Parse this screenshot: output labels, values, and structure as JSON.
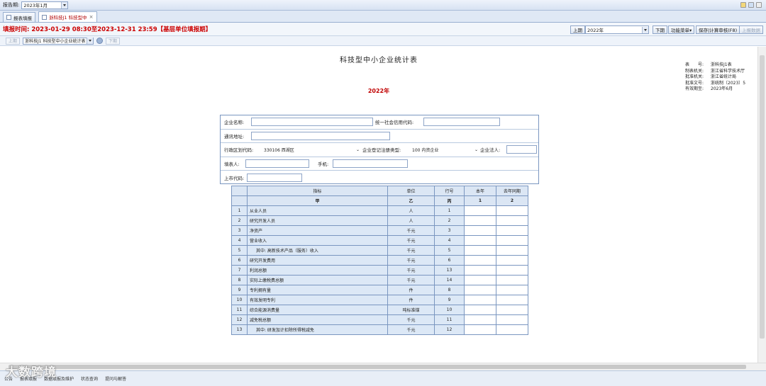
{
  "topbar": {
    "period_label": "报告期:",
    "period_value": "2023年1月"
  },
  "tabs": [
    {
      "label": "报表填报"
    },
    {
      "label": "浙科技J1 科技型中"
    }
  ],
  "timebar": {
    "fill_time": "填报时间: 2023-01-29 08:30至2023-12-31 23:59【基层单位填报期】",
    "prev_btn": "上期",
    "year_value": "2022年",
    "next_btn": "下期",
    "func_menu": "功能菜单▾",
    "save_btn": "保存|计算审核(F8)",
    "report_btn": "上报数据"
  },
  "toolbar2": {
    "btn_prev": "上期",
    "table_select": "浙科技J1 科技型中小企业统计表",
    "btn_next": "下期"
  },
  "form": {
    "title": "科技型中小企业统计表",
    "year": "2022年",
    "meta": [
      {
        "k": "表　　号:",
        "v": "浙科技J1表"
      },
      {
        "k": "制表机关:",
        "v": "浙江省科学技术厅"
      },
      {
        "k": "批准机关:",
        "v": "浙江省统计局"
      },
      {
        "k": "批准文号:",
        "v": "浙统制〔2023〕5"
      },
      {
        "k": "有效期至:",
        "v": "2023年6月"
      }
    ]
  },
  "info": {
    "company_name_label": "企业名称:",
    "credit_code_label": "统一社会信用代码:",
    "address_label": "通讯地址:",
    "region_label": "行政区划代码:",
    "region_value": "330106 西湖区",
    "reg_type_label": "企业登记注册类型:",
    "reg_type_value": "100 内资企业",
    "legal_label": "企业法人:",
    "filler_label": "填表人:",
    "mobile_label": "手机:",
    "listed_label": "上市代码:"
  },
  "table": {
    "headers": {
      "indicator": "指标",
      "unit": "单位",
      "row_no": "行号",
      "this_year": "本年",
      "last_year": "去年同期"
    },
    "codes": {
      "indicator": "甲",
      "unit": "乙",
      "row_no": "丙",
      "this_year": "1",
      "last_year": "2"
    },
    "rows": [
      {
        "seq": "1",
        "name": "从业人员",
        "unit": "人",
        "row": "1",
        "indent": false
      },
      {
        "seq": "2",
        "name": "研究开发人员",
        "unit": "人",
        "row": "2",
        "indent": false
      },
      {
        "seq": "3",
        "name": "净资产",
        "unit": "千元",
        "row": "3",
        "indent": false
      },
      {
        "seq": "4",
        "name": "营业收入",
        "unit": "千元",
        "row": "4",
        "indent": false
      },
      {
        "seq": "5",
        "name": "其中: 高新技术产品（服务）收入",
        "unit": "千元",
        "row": "5",
        "indent": true
      },
      {
        "seq": "6",
        "name": "研究开发费用",
        "unit": "千元",
        "row": "6",
        "indent": false
      },
      {
        "seq": "7",
        "name": "利润总额",
        "unit": "千元",
        "row": "13",
        "indent": false
      },
      {
        "seq": "8",
        "name": "实际上缴税费总额",
        "unit": "千元",
        "row": "14",
        "indent": false
      },
      {
        "seq": "9",
        "name": "专利拥有量",
        "unit": "件",
        "row": "8",
        "indent": false
      },
      {
        "seq": "10",
        "name": "有效发明专利",
        "unit": "件",
        "row": "9",
        "indent": false
      },
      {
        "seq": "11",
        "name": "综合能源消费量",
        "unit": "吨标准煤",
        "row": "10",
        "indent": false
      },
      {
        "seq": "12",
        "name": "减免税总额",
        "unit": "千元",
        "row": "11",
        "indent": false
      },
      {
        "seq": "13",
        "name": "其中: 研发加计扣除所得税减免",
        "unit": "千元",
        "row": "12",
        "indent": true
      }
    ]
  },
  "statusbar": [
    "公告",
    "报表填报",
    "数据填报及维护",
    "状态查询",
    "提问与解答"
  ],
  "watermark": "大数跨境"
}
